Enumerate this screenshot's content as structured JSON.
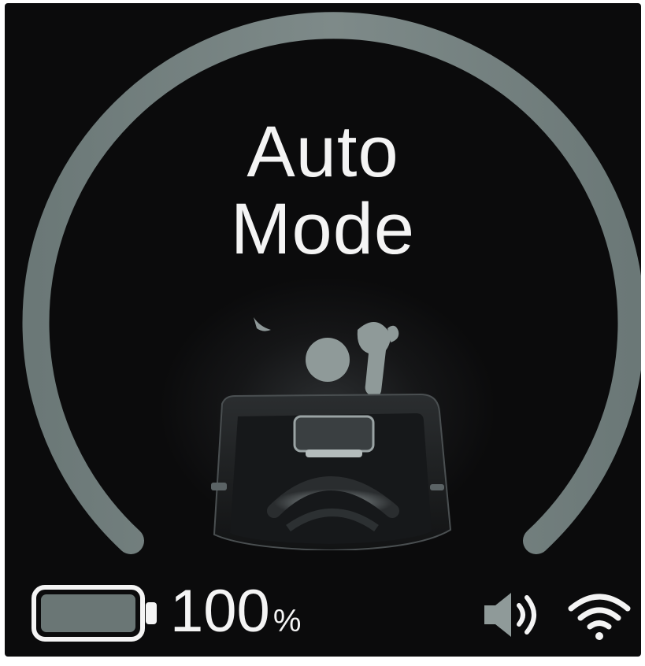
{
  "mode": {
    "line1": "Auto",
    "line2": "Mode"
  },
  "status": {
    "battery_level": "100",
    "battery_unit": "%",
    "battery_fill_percent": 100
  },
  "icons": {
    "battery": "battery-icon",
    "speaker": "speaker-volume-icon",
    "wifi": "wifi-icon",
    "illustration": "person-in-seat-illustration"
  },
  "colors": {
    "background": "#0b0b0c",
    "arc": "#6e7a7a",
    "text": "#f4f4f4",
    "battery_fill": "#6a7675"
  }
}
